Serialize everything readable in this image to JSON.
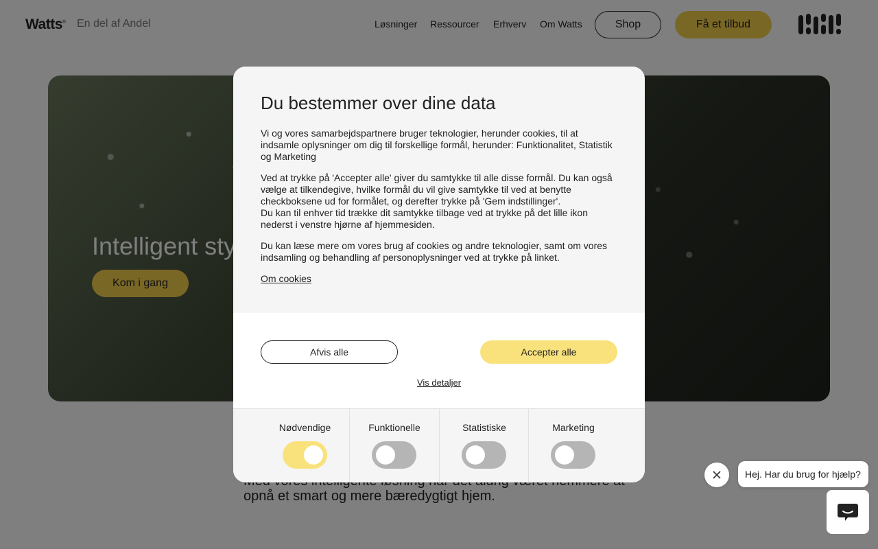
{
  "header": {
    "logo": "Watts",
    "subbrand": "En del af Andel",
    "nav": [
      "Løsninger",
      "Ressourcer",
      "Erhverv",
      "Om Watts"
    ],
    "shop_label": "Shop",
    "quote_label": "Få et tilbud"
  },
  "hero": {
    "title": "Intelligent styring",
    "cta_label": "Kom i gang"
  },
  "body_text": "Med vores intelligente løsning har det aldrig været nemmere at opnå et smart og mere bæredygtigt hjem.",
  "chat": {
    "greeting": "Hej. Har du brug for hjælp?"
  },
  "consent": {
    "title": "Du bestemmer over dine data",
    "paragraphs": [
      "Vi og vores samarbejdspartnere bruger teknologier, herunder cookies, til at indsamle oplysninger om dig til forskellige formål, herunder: Funktionalitet, Statistik og Marketing",
      "Ved at trykke på 'Accepter alle' giver du samtykke til alle disse formål. Du kan også vælge at tilkendegive, hvilke formål du vil give samtykke til ved at benytte checkboksene ud for formålet, og derefter trykke på 'Gem indstillinger'.\nDu kan til enhver tid trække dit samtykke tilbage ved at trykke på det lille ikon nederst i venstre hjørne af hjemmesiden.",
      "Du kan læse mere om vores brug af cookies og andre teknologier, samt om vores indsamling og behandling af personoplysninger ved at trykke på linket."
    ],
    "about_link": "Om cookies",
    "reject_label": "Afvis alle",
    "accept_label": "Accepter alle",
    "details_link": "Vis detaljer",
    "categories": [
      {
        "label": "Nødvendige",
        "enabled": true
      },
      {
        "label": "Funktionelle",
        "enabled": false
      },
      {
        "label": "Statistiske",
        "enabled": false
      },
      {
        "label": "Marketing",
        "enabled": false
      }
    ]
  },
  "colors": {
    "accent_yellow": "#f3cf4b",
    "accent_light_yellow": "#f9e27c",
    "overlay": "rgba(0,0,0,0.5)"
  }
}
